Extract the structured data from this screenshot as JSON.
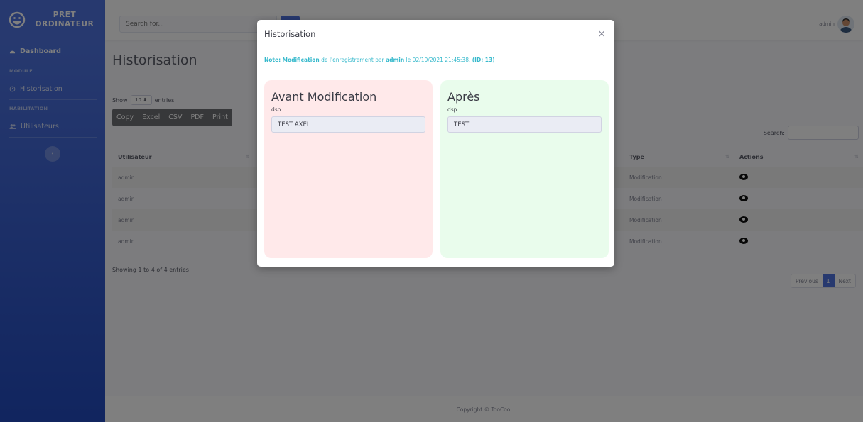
{
  "brand": {
    "line1": "PRET",
    "line2": "ORDINATEUR"
  },
  "sidebar": {
    "dashboard": "Dashboard",
    "module_heading": "MODULE",
    "historisation": "Historisation",
    "habilitation_heading": "HABILITATION",
    "utilisateurs": "Utilisateurs",
    "toggle_icon": "chevron-left-icon"
  },
  "topbar": {
    "search_placeholder": "Search for...",
    "user_name": "admin"
  },
  "page": {
    "title": "Historisation"
  },
  "table_controls": {
    "show": "Show",
    "length": "10",
    "entries": "entries",
    "buttons": [
      "Copy",
      "Excel",
      "CSV",
      "PDF",
      "Print"
    ],
    "search_label": "Search:"
  },
  "table": {
    "headers": {
      "utilisateur": "Utilisateur",
      "type": "Type",
      "actions": "Actions"
    },
    "rows": [
      {
        "user": "admin",
        "type": "Modification"
      },
      {
        "user": "admin",
        "type": "Modification"
      },
      {
        "user": "admin",
        "type": "Modification"
      },
      {
        "user": "admin",
        "type": "Modification"
      }
    ],
    "info": "Showing 1 to 4 of 4 entries",
    "pager": {
      "previous": "Previous",
      "page": "1",
      "next": "Next"
    }
  },
  "footer": {
    "copyright": "Copyright © TooCool"
  },
  "modal": {
    "title": "Historisation",
    "close": "×",
    "note_prefix": "Note:",
    "note_action": "Modification",
    "note_text1": "de l'enregistrement par",
    "note_user": "admin",
    "note_text2": "le 02/10/2021 21:45:38.",
    "note_id": "(ID: 13)",
    "before": {
      "title": "Avant Modification",
      "label": "dsp",
      "value": "TEST AXEL"
    },
    "after": {
      "title": "Après",
      "label": "dsp",
      "value": "TEST"
    }
  },
  "colors": {
    "primary": "#4e73df",
    "info": "#36b9cc",
    "before_bg": "#ffe9ea",
    "after_bg": "#e9fcec"
  }
}
